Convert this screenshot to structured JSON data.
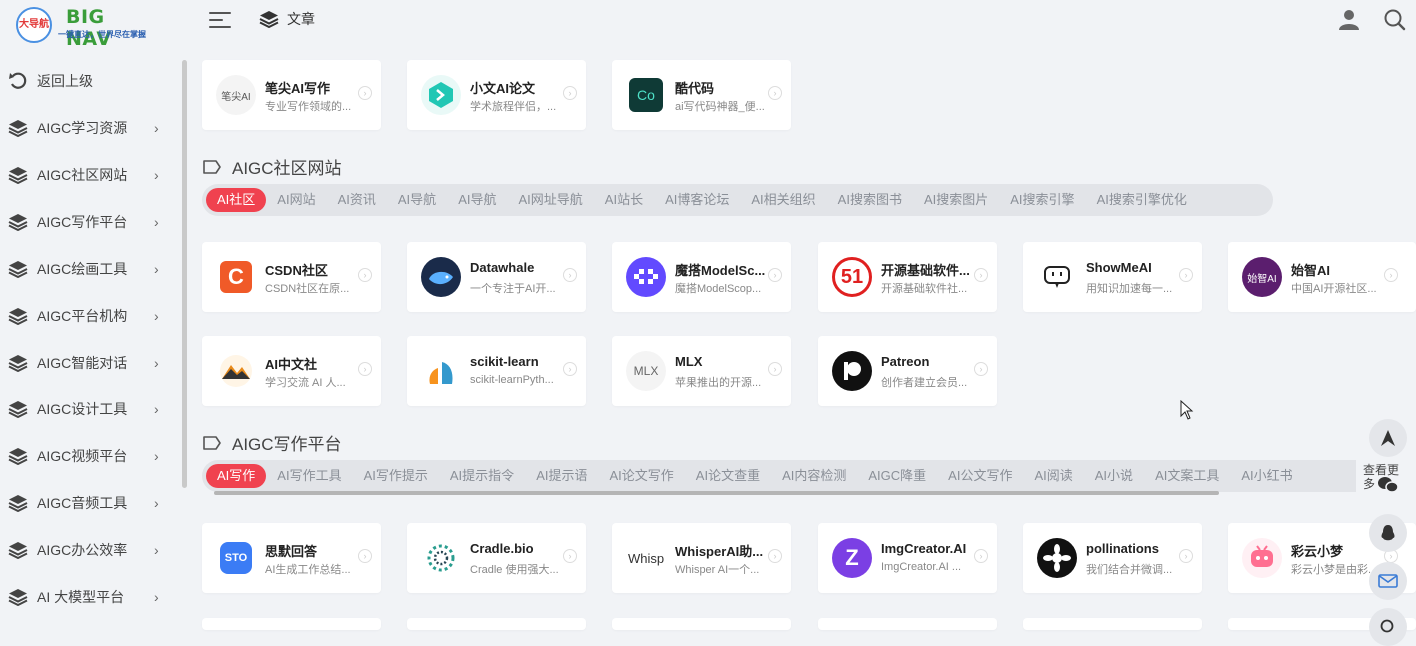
{
  "brand": {
    "logo_mark": "大导航",
    "title": "BIG NAV",
    "subtitle": "一键直达，世界尽在掌握"
  },
  "header": {
    "nav_label": "文章",
    "icons": [
      "menu-icon",
      "layers-icon",
      "user-icon",
      "search-icon"
    ]
  },
  "sidebar": {
    "items": [
      {
        "label": "返回上级",
        "icon": "back-icon"
      },
      {
        "label": "AIGC学习资源",
        "icon": "layers-icon"
      },
      {
        "label": "AIGC社区网站",
        "icon": "layers-icon"
      },
      {
        "label": "AIGC写作平台",
        "icon": "layers-icon"
      },
      {
        "label": "AIGC绘画工具",
        "icon": "layers-icon"
      },
      {
        "label": "AIGC平台机构",
        "icon": "layers-icon"
      },
      {
        "label": "AIGC智能对话",
        "icon": "layers-icon"
      },
      {
        "label": "AIGC设计工具",
        "icon": "layers-icon"
      },
      {
        "label": "AIGC视频平台",
        "icon": "layers-icon"
      },
      {
        "label": "AIGC音频工具",
        "icon": "layers-icon"
      },
      {
        "label": "AIGC办公效率",
        "icon": "layers-icon"
      },
      {
        "label": "AI 大模型平台",
        "icon": "layers-icon"
      }
    ]
  },
  "top_cards": [
    {
      "title": "笔尖AI写作",
      "desc": "专业写作领域的...",
      "icon_text": "笔尖AI"
    },
    {
      "title": "小文AI论文",
      "desc": "学术旅程伴侣，...",
      "icon_text": ""
    },
    {
      "title": "酷代码",
      "desc": "ai写代码神器_便...",
      "icon_text": "Co"
    }
  ],
  "community": {
    "title": "AIGC社区网站",
    "tabs": [
      "AI社区",
      "AI网站",
      "AI资讯",
      "AI导航",
      "AI导航",
      "AI网址导航",
      "AI站长",
      "AI博客论坛",
      "AI相关组织",
      "AI搜索图书",
      "AI搜索图片",
      "AI搜索引擎",
      "AI搜索引擎优化"
    ],
    "cards": [
      {
        "title": "CSDN社区",
        "desc": "CSDN社区在原...",
        "icon_text": "C",
        "color": "#f05a28"
      },
      {
        "title": "Datawhale",
        "desc": "一个专注于AI开...",
        "icon_text": "",
        "color": "#1a2b4a"
      },
      {
        "title": "魔搭ModelSc...",
        "desc": "魔搭ModelScop...",
        "icon_text": "",
        "color": "#624aff"
      },
      {
        "title": "开源基础软件...",
        "desc": "开源基础软件社...",
        "icon_text": "51",
        "color": "#e02020"
      },
      {
        "title": "ShowMeAI",
        "desc": "用知识加速每一...",
        "icon_text": "",
        "color": "#ffffff"
      },
      {
        "title": "始智AI",
        "desc": "中国AI开源社区...",
        "icon_text": "始智AI",
        "color": "#5b1e6e"
      },
      {
        "title": "AI中文社",
        "desc": "学习交流 AI 人...",
        "icon_text": "",
        "color": "#ffffff"
      },
      {
        "title": "scikit-learn",
        "desc": "scikit-learnPyth...",
        "icon_text": "",
        "color": "#ffffff"
      },
      {
        "title": "MLX",
        "desc": "苹果推出的开源...",
        "icon_text": "MLX",
        "color": "#f4f4f4"
      },
      {
        "title": "Patreon",
        "desc": "创作者建立会员...",
        "icon_text": "",
        "color": "#111111"
      }
    ]
  },
  "writing": {
    "title": "AIGC写作平台",
    "tabs": [
      "AI写作",
      "AI写作工具",
      "AI写作提示",
      "AI提示指令",
      "AI提示语",
      "AI论文写作",
      "AI论文查重",
      "AI内容检测",
      "AIGC降重",
      "AI公文写作",
      "AI阅读",
      "AI小说",
      "AI文案工具",
      "AI小红书"
    ],
    "cards": [
      {
        "title": "思默回答",
        "desc": "AI生成工作总结...",
        "icon_text": "STO",
        "color": "#3b7cf5"
      },
      {
        "title": "Cradle.bio",
        "desc": "Cradle 使用强大...",
        "icon_text": "",
        "color": "#ffffff"
      },
      {
        "title": "WhisperAI助...",
        "desc": "Whisper AI一个...",
        "icon_text": "Whisp",
        "color": "#ffffff"
      },
      {
        "title": "ImgCreator.AI",
        "desc": "ImgCreator.AI ...",
        "icon_text": "Z",
        "color": "#7b3fe4"
      },
      {
        "title": "pollinations",
        "desc": "我们结合并微调...",
        "icon_text": "",
        "color": "#111111"
      },
      {
        "title": "彩云小梦",
        "desc": "彩云小梦是由彩...",
        "icon_text": "",
        "color": "#fff0f4"
      }
    ]
  },
  "float": {
    "more_label": "查看更多"
  }
}
